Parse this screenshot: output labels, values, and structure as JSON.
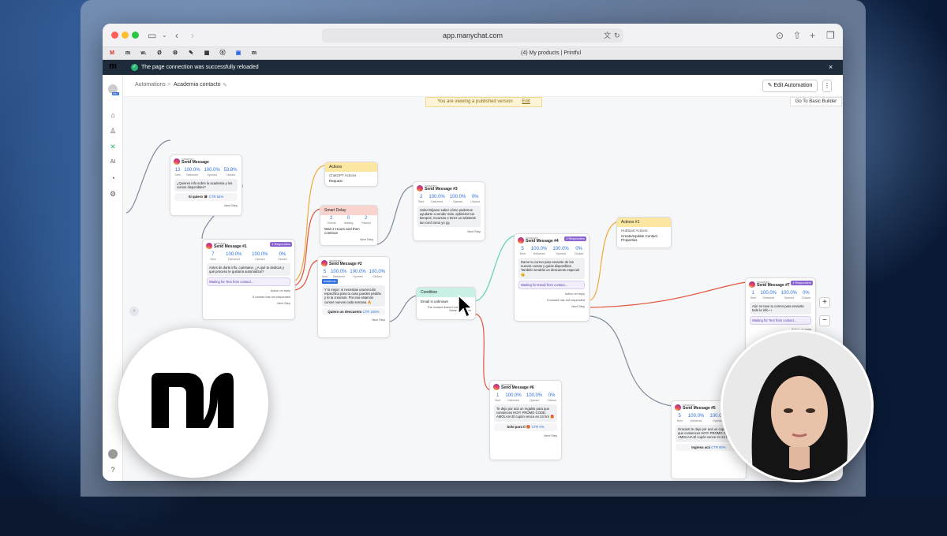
{
  "browser": {
    "url": "app.manychat.com",
    "tab_title": "(4) My products | Printful",
    "favicons": [
      "M",
      "m",
      "w.",
      "Ø",
      "⚙",
      "✎",
      "▦",
      "ⓞ",
      "▣",
      "m"
    ]
  },
  "banner": {
    "text": "The page connection was successfully reloaded",
    "close": "×"
  },
  "breadcrumb": {
    "root": "Automations",
    "separator": ">",
    "current": "Academia contacto"
  },
  "header": {
    "edit_button": "Edit Automation",
    "more": "⋮",
    "published_notice": "You are viewing a published version",
    "published_edit": "Edit",
    "basic_builder": "Go To Basic Builder"
  },
  "rail": {
    "logo": "m",
    "badge": "PRO"
  },
  "stat_labels": {
    "sent": "Sent",
    "delivered": "Delivered",
    "opened": "Opened",
    "clicked": "Clicked"
  },
  "nodes": {
    "sm1": {
      "channel": "Instagram",
      "title": "Send Message",
      "stats": [
        "13",
        "100.0%",
        "100.0%",
        "53.8%"
      ],
      "text": "¿Quieres info sobre la academia y los cursos disponibles?",
      "button": "Sí quiero 🎓",
      "ctr": "CTR 54%",
      "next": "Next Step"
    },
    "smA": {
      "channel": "Instagram",
      "title": "Send Message #1",
      "badge": "1 Responders",
      "stats": [
        "7",
        "100.0%",
        "100.0%",
        "0%"
      ],
      "text": "Antes de darte info, cuéntame, ¿A qué te dedicas y qué proceso te gustaría automatizar?",
      "wait": "Waiting for Text from contact...",
      "on_reply": "Action on reply",
      "no_reply": "If contact has not responded",
      "next": "Next Step"
    },
    "act1": {
      "title": "Actions",
      "line1": "ChatGPT Actions",
      "line2": "Request"
    },
    "delay": {
      "title": "Smart Delay",
      "stats": [
        "2",
        "0",
        "2"
      ],
      "labels": [
        "Overall",
        "Waiting",
        "Passed"
      ],
      "text": "Wait 2 Hours and then continue",
      "next": "Next Step"
    },
    "sm2": {
      "channel": "Instagram",
      "title": "Send Message #2",
      "stats": [
        "5",
        "100.0%",
        "100.0%",
        "100.0%"
      ],
      "tag": "Academia",
      "text": "Y lo mejor: si necesitas una lección específica para tu caso puedes pedirla y te la creamos. Por eso estamos cursos nuevos cada semana 🔥",
      "button": "Quiero un descuento",
      "ctr": "CTR 100%",
      "next": "Next Step"
    },
    "sm3": {
      "channel": "Instagram",
      "title": "Send Message #3",
      "stats": [
        "2",
        "100.0%",
        "100.0%",
        "0%"
      ],
      "text": "Hola! Déjame saber cómo podemos ayudarte a vender más, optimizar tus tiempos, recursos o tener un asistente tan cool como yo 🤖",
      "next": "Next Step"
    },
    "cond": {
      "title": "Condition",
      "rule": "Email is unknown",
      "else": "The contact doesn't match any of these conditions"
    },
    "sm4": {
      "channel": "Instagram",
      "title": "Send Message #4",
      "badge": "4 Responders",
      "stats": [
        "5",
        "100.0%",
        "100.0%",
        "0%"
      ],
      "text": "Dame tu correo para enviarte de los nuevos cursos y guías disponibles. También tendrás un descuento especial 😉",
      "wait": "Waiting for Email from contact...",
      "on_reply": "Action on reply",
      "no_reply": "If contact has not responded",
      "next": "Next Step"
    },
    "act2": {
      "title": "Actions #1",
      "line1": "HubSpot Actions:",
      "line2": "Create/Update Contact Properties"
    },
    "sm7": {
      "channel": "Instagram",
      "title": "Send Message #7",
      "badge": "1 Responders",
      "stats": [
        "1",
        "100.0%",
        "100.0%",
        "0%"
      ],
      "text": "Aún no tuve tu correo para enviarte todo la info 👀",
      "wait": "Waiting for Text from contact...",
      "on_reply": "Action on reply",
      "no_reply": "If contact has not responded"
    },
    "sm6": {
      "channel": "Instagram",
      "title": "Send Message #6",
      "stats": [
        "1",
        "100.0%",
        "100.0%",
        "0%"
      ],
      "text": "Te dejo por acá un regalito para que comiences HOY! PROMO CODE: AMOLAIA El cupón vence en 24 hrs 🎁",
      "button": "Solo para ti 🎁",
      "ctr": "CTR 0%",
      "next": "Next Step"
    },
    "sm5": {
      "channel": "Instagram",
      "title": "Send Message #5",
      "stats": [
        "5",
        "100.0%",
        "100.0%",
        "0%"
      ],
      "text": "Gracias! te dejo por acá un cupón para que comiences HOY! PROMO CODE: AMOLAIA El cupón vence en 24 hrs",
      "button": "Ingresa acá",
      "ctr": "CTR 80%"
    }
  },
  "zoom": {
    "in": "+",
    "out": "−"
  },
  "colors": {
    "banner": "#1d2b3a",
    "link_orange": "#f0a83a",
    "link_red": "#e2553c",
    "link_teal": "#5fd0b0",
    "link_gray": "#7c8a9c",
    "accent_blue": "#2a6fdb",
    "badge_purple": "#8a63d2"
  }
}
